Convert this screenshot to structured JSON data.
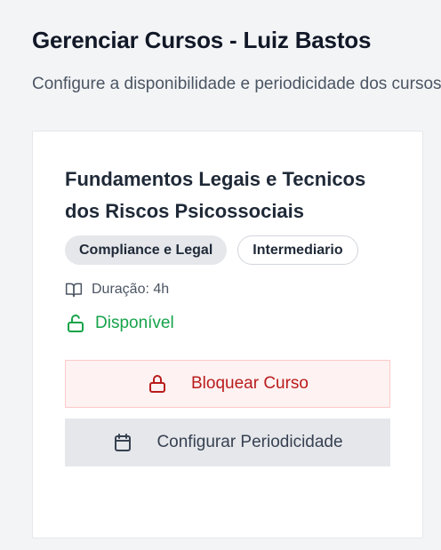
{
  "header": {
    "title": "Gerenciar Cursos - Luiz Bastos",
    "subtitle": "Configure a disponibilidade e periodicidade dos cursos"
  },
  "course": {
    "title": "Fundamentos Legais e Tecnicos dos Riscos Psicossociais",
    "badges": [
      "Compliance e Legal",
      "Intermediario"
    ],
    "duration": "Duração: 4h",
    "status": "Disponível",
    "block_button": "Bloquear Curso",
    "config_button": "Configurar Periodicidade"
  },
  "icons": {
    "duration": "book-open-icon",
    "status": "unlock-icon",
    "block": "lock-icon",
    "config": "calendar-icon"
  },
  "colors": {
    "status_green": "#16a34a",
    "block_red": "#b91c1c",
    "block_bg": "#fef2f2",
    "config_bg": "#e5e7eb"
  }
}
